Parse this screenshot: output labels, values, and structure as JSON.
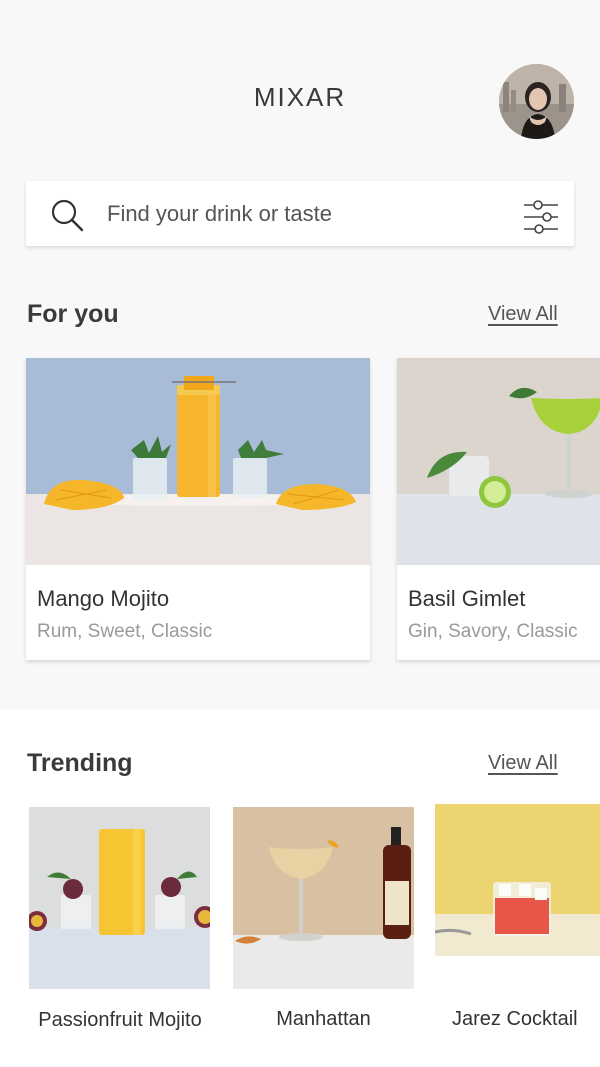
{
  "header": {
    "title": "MIXAR",
    "avatar_alt": "profile photo"
  },
  "search": {
    "placeholder": "Find your drink or taste",
    "value": ""
  },
  "icons": {
    "search": "search-icon",
    "filter": "sliders-icon"
  },
  "for_you": {
    "title": "For you",
    "view_all": "View All",
    "cards": [
      {
        "name": "Mango Mojito",
        "tags": "Rum, Sweet, Classic"
      },
      {
        "name": "Basil Gimlet",
        "tags": "Gin, Savory, Classic"
      }
    ]
  },
  "trending": {
    "title": "Trending",
    "view_all": "View All",
    "items": [
      {
        "name": "Passionfruit Mojito"
      },
      {
        "name": "Manhattan"
      },
      {
        "name": "Jarez Cocktail"
      }
    ]
  },
  "colors": {
    "background": "#f9f8f9",
    "mango_bg": "#a8bcd8",
    "gimlet_bg": "#dcd5cd",
    "manhattan_bg": "#d8c0a2",
    "jarez_bg": "#ecd570"
  }
}
